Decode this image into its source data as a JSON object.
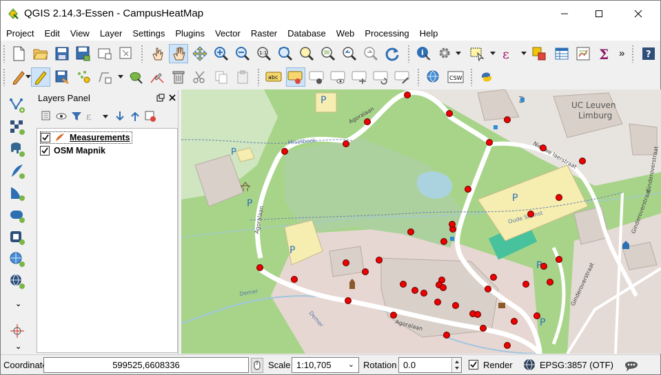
{
  "window": {
    "title": "QGIS 2.14.3-Essen - CampusHeatMap",
    "minimize_icon": "minimize-icon",
    "maximize_icon": "maximize-icon",
    "close_icon": "close-icon"
  },
  "menubar": {
    "items": [
      "Project",
      "Edit",
      "View",
      "Layer",
      "Settings",
      "Plugins",
      "Vector",
      "Raster",
      "Database",
      "Web",
      "Processing",
      "Help"
    ]
  },
  "toolbar": {
    "more_label": "»",
    "label_abc": "abc",
    "csw_label": "CSW"
  },
  "layers_panel": {
    "title": "Layers Panel",
    "layers": [
      {
        "name": "Measurements",
        "checked": true,
        "selected": true,
        "icon": "point-layer-icon"
      },
      {
        "name": "OSM Mapnik",
        "checked": true,
        "selected": false,
        "icon": ""
      }
    ]
  },
  "map": {
    "labels": {
      "agoralaan_1": "Agoralaan",
      "agoralaan_2": "Agoralaan",
      "agoralaan_3": "Agoralaan",
      "misset": "Misetbeek",
      "demer": "Demer",
      "demer2": "Demer",
      "nieuwe": "Nieuwe laerstraat",
      "uc_leuven": "UC Leuven",
      "limburg": "Limburg",
      "ginder1": "Ginderoverstraat",
      "ginder2": "Ginderoverstraat",
      "ginder3": "Ginderoverstraat",
      "p": "P",
      "a_label": "Ag",
      "oude": "Oude Steinst"
    },
    "accent": {
      "point_fill": "#ee0000",
      "road": "#ffffff",
      "grass": "#a8d48a",
      "parking": "#f5eeb0",
      "building": "#d9d0c9",
      "water": "#aad3df"
    }
  },
  "statusbar": {
    "coordinate_label": "Coordinate",
    "coordinate_value": "599525,6608336",
    "scale_label": "Scale",
    "scale_value": "1:10,705",
    "rotation_label": "Rotation",
    "rotation_value": "0.0",
    "render_label": "Render",
    "render_checked": true,
    "crs_label": "EPSG:3857 (OTF)"
  }
}
